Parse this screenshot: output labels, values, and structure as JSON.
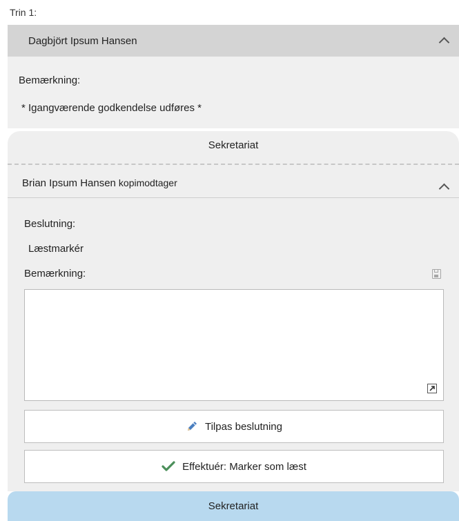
{
  "step_label": "Trin 1:",
  "section1": {
    "name": "Dagbjört Ipsum Hansen",
    "remark_label": "Bemærkning:",
    "remark_text": "* Igangværende godkendelse udføres *"
  },
  "card": {
    "title": "Sekretariat",
    "person_name": "Brian Ipsum Hansen",
    "person_role": "kopimodtager",
    "decision_label": "Beslutning:",
    "decision_value": "Læstmarkér",
    "remark_label": "Bemærkning:",
    "remark_value": ""
  },
  "buttons": {
    "adjust_label": "Tilpas beslutning",
    "effect_label": "Effektuér: Marker som læst"
  },
  "bottom_bar": {
    "label": "Sekretariat"
  },
  "icons": {
    "collapse": "chevron-up-icon",
    "save": "save-icon",
    "expand": "expand-icon",
    "pencil": "pencil-icon",
    "check": "check-icon"
  },
  "colors": {
    "header_bg": "#d4d4d4",
    "panel_bg": "#efefef",
    "bottom_bar_bg": "#b8d9ef",
    "check_green": "#4b8f5a",
    "pencil_blue": "#4a7fc0"
  }
}
